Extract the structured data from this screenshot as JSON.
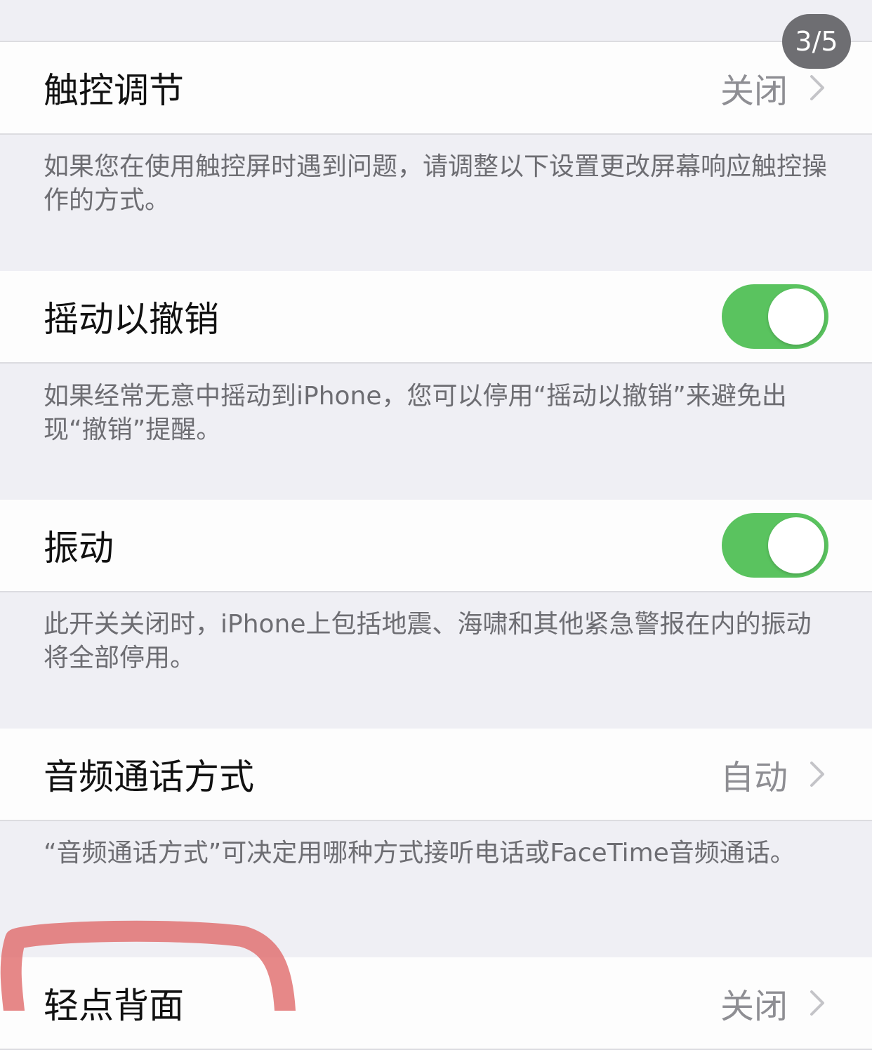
{
  "image_counter": "3/5",
  "rows": [
    {
      "label": "触控调节",
      "value": "关闭"
    },
    {
      "label": "摇动以撤销",
      "toggle_on": true
    },
    {
      "label": "振动",
      "toggle_on": true
    },
    {
      "label": "音频通话方式",
      "value": "自动"
    },
    {
      "label": "轻点背面",
      "value": "关闭"
    }
  ],
  "footers": [
    "如果您在使用触控屏时遇到问题，请调整以下设置更改屏幕响应触控操作的方式。",
    "如果经常无意中摇动到iPhone，您可以停用“摇动以撤销”来避免出现“撤销”提醒。",
    "此开关关闭时，iPhone上包括地震、海啸和其他紧急警报在内的振动将全部停用。",
    "“音频通话方式”可决定用哪种方式接听电话或FaceTime音频通话。"
  ],
  "colors": {
    "toggle_on": "#5ac35f",
    "annotation": "#e06a6a"
  }
}
